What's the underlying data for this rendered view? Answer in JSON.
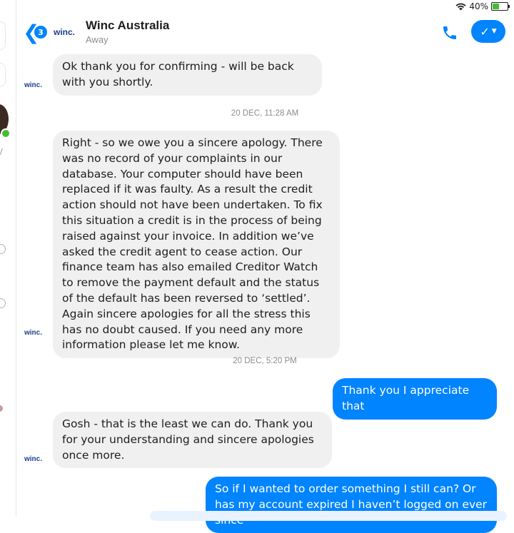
{
  "status_bar": {
    "battery": "40%"
  },
  "header": {
    "back_count": "3",
    "logo_text": "winc.",
    "title": "Winc Australia",
    "presence": "Away"
  },
  "messages": [
    {
      "type": "in",
      "text": "Ok thank you for confirming - will be back with you shortly."
    },
    {
      "type": "timestamp",
      "text": "20 DEC, 11:28 AM"
    },
    {
      "type": "in",
      "text": "Right - so we owe you a sincere apology. There was no record of your complaints in our database. Your computer should have been replaced if it was faulty. As a result the credit action should not have been undertaken. To fix this situation a credit is in the process of being raised against your invoice. In addition we’ve asked the credit agent to cease action. Our finance team has also emailed Creditor Watch to remove the payment default and the status of the default has been reversed to ‘settled’. Again sincere apologies for all the stress this has no doubt caused. If you need any more information please let me know."
    },
    {
      "type": "timestamp",
      "text": "20 DEC, 5:20 PM"
    },
    {
      "type": "out",
      "text": "Thank you I appreciate that"
    },
    {
      "type": "in",
      "text": "Gosh - that is the least we can do. Thank you for your understanding and sincere apologies once more."
    },
    {
      "type": "out",
      "text": "So if I wanted to order something I still can? Or has my account expired I haven’t logged on ever since"
    }
  ],
  "colors": {
    "accent": "#0084ff",
    "incoming_bubble": "#f1f0f0"
  }
}
